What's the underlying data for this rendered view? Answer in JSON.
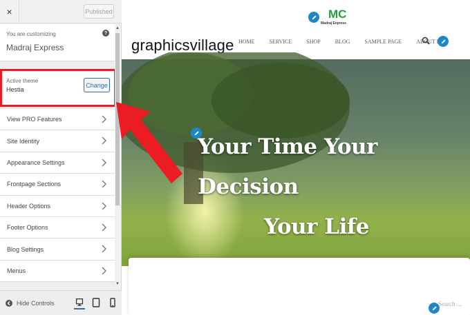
{
  "sidebar": {
    "close_label": "×",
    "published_label": "Published",
    "customizing_label": "You are customizing",
    "site_title": "Madraj Express",
    "help_label": "?",
    "active_theme_label": "Active theme",
    "theme_name": "Hestia",
    "change_label": "Change",
    "items": [
      {
        "label": "View PRO Features"
      },
      {
        "label": "Site Identity"
      },
      {
        "label": "Appearance Settings"
      },
      {
        "label": "Frontpage Sections"
      },
      {
        "label": "Header Options"
      },
      {
        "label": "Footer Options"
      },
      {
        "label": "Blog Settings"
      },
      {
        "label": "Menus"
      }
    ],
    "footer": {
      "hide_controls_label": "Hide Controls",
      "devices": [
        "desktop-icon",
        "tablet-icon",
        "mobile-icon"
      ]
    }
  },
  "preview": {
    "logo_text": "Madraj Express",
    "logo_letters": "MC",
    "site_name": "graphicsvillage",
    "nav": [
      "HOME",
      "SERVICE",
      "SHOP",
      "BLOG",
      "SAMPLE PAGE",
      "ABOUT ME"
    ],
    "hero_line1": "Your Time Your Decision",
    "hero_line2": "Your Life",
    "search_placeholder": "Search ...",
    "accent_color": "#1e88c7",
    "annotation_color": "#ec1c24"
  }
}
